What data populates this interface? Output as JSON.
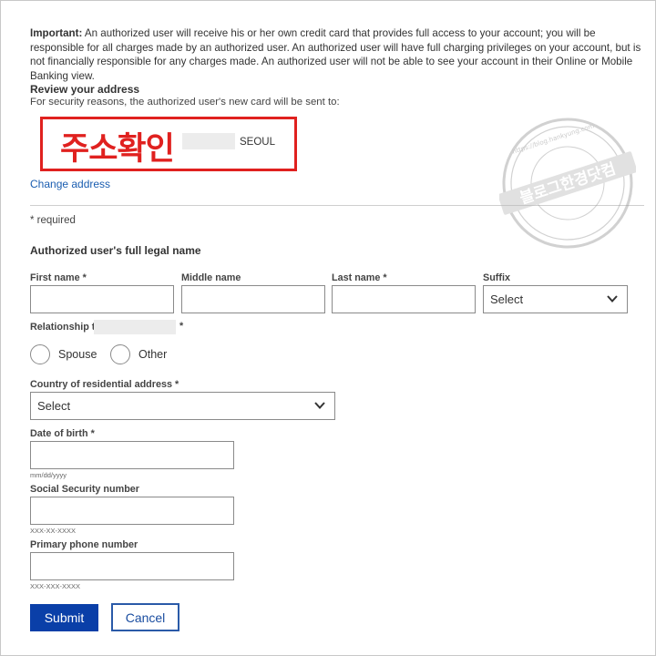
{
  "notice": {
    "important_label": "Important:",
    "important_text": " An authorized user will receive his or her own credit card that provides full access to your account; you will be responsible for all charges made by an authorized user. An authorized user will have full charging privileges on your account, but is not financially responsible for any charges made. An authorized user will not be able to see your account in their Online or Mobile Banking view."
  },
  "address": {
    "heading": "Review your address",
    "security_text": "For security reasons, the authorized user's new card will be sent to:",
    "annotation": "주소확인",
    "city": "SEOUL",
    "change_link": "Change address"
  },
  "form": {
    "required_note": "* required",
    "section_heading": "Authorized user's full legal name",
    "first_name_label": "First name *",
    "middle_name_label": "Middle name",
    "last_name_label": "Last name *",
    "suffix_label": "Suffix",
    "suffix_value": "Select",
    "relationship_label": "Relationship to",
    "relationship_required": "*",
    "relationship_options": [
      "Spouse",
      "Other"
    ],
    "country_label": "Country of residential address *",
    "country_value": "Select",
    "dob_label": "Date of birth *",
    "dob_hint": "mm/dd/yyyy",
    "ssn_label": "Social Security number",
    "ssn_hint": "XXX-XX-XXXX",
    "phone_label": "Primary phone number",
    "phone_hint": "XXX-XXX-XXXX",
    "submit_label": "Submit",
    "cancel_label": "Cancel"
  },
  "watermark": {
    "main_text": "블로그한경닷컴",
    "url_text": "https://blog.hankyung.com"
  },
  "colors": {
    "annotation_red": "#e0211f",
    "link_blue": "#1a5db0",
    "submit_blue": "#0a3fa8",
    "border_gray": "#8a8a8a"
  }
}
